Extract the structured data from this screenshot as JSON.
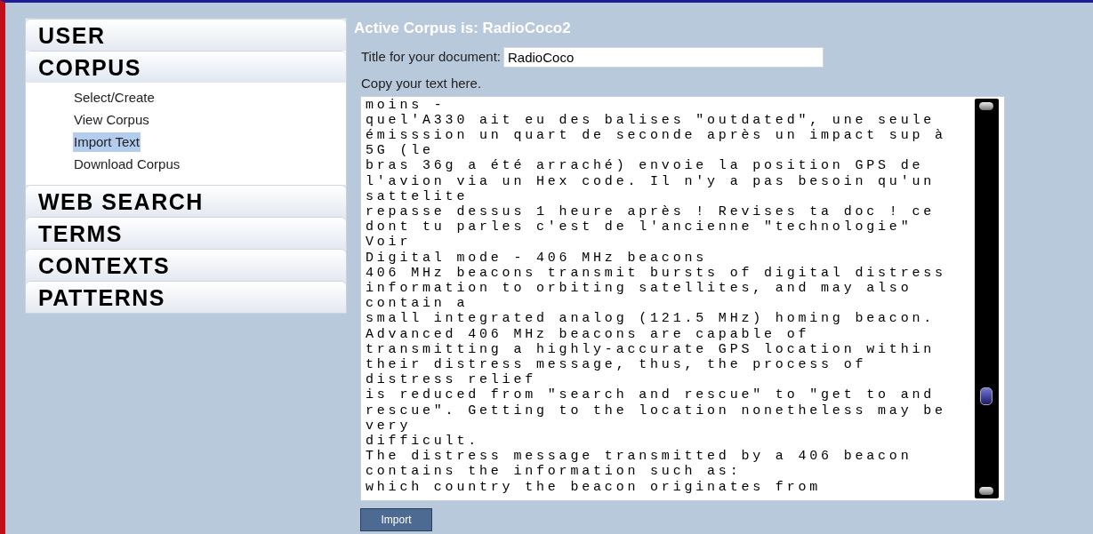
{
  "sidebar": {
    "sections": [
      {
        "label": "USER",
        "expanded": false
      },
      {
        "label": "CORPUS",
        "expanded": true,
        "items": [
          {
            "label": "Select/Create",
            "selected": false
          },
          {
            "label": "View Corpus",
            "selected": false
          },
          {
            "label": "Import Text",
            "selected": true
          },
          {
            "label": "Download Corpus",
            "selected": false
          }
        ]
      },
      {
        "label": "WEB SEARCH",
        "expanded": false
      },
      {
        "label": "TERMS",
        "expanded": false
      },
      {
        "label": "CONTEXTS",
        "expanded": false
      },
      {
        "label": "PATTERNS",
        "expanded": false
      }
    ]
  },
  "main": {
    "heading": "Active Corpus is: RadioCoco2",
    "title_label": "Title for your document:",
    "title_value": "RadioCoco",
    "text_label": "Copy your text here.",
    "text_lines": [
      "moins -",
      "quel'A330 ait eu des balises \"outdated\", une seule",
      "émisssion un quart de seconde après un impact sup à",
      "5G (le",
      "bras 36g a été arraché) envoie la position GPS de",
      "l'avion via un Hex code. Il n'y a pas besoin qu'un",
      "sattelite",
      "repasse dessus 1 heure après ! Revises ta doc ! ce",
      "dont tu parles c'est de l'ancienne \"technologie\"",
      "Voir",
      "Digital mode - 406 MHz beacons",
      "406 MHz beacons transmit bursts of digital distress",
      "information to orbiting satellites, and may also",
      "contain a",
      "small integrated analog (121.5 MHz) homing beacon.",
      "Advanced 406 MHz beacons are capable of",
      "transmitting a highly-accurate GPS location within",
      "their distress message, thus, the process of",
      "distress relief",
      "is reduced from \"search and rescue\" to \"get to and",
      "rescue\". Getting to the location nonetheless may be",
      "very",
      "difficult.",
      "The distress message transmitted by a 406 beacon",
      "contains the information such as:",
      "which country the beacon originates from"
    ],
    "button": "Import"
  }
}
